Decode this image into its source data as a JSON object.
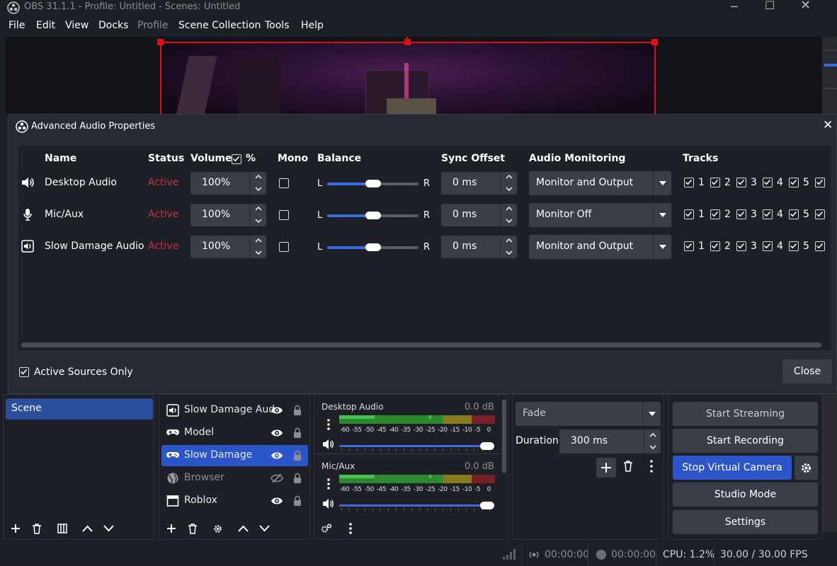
{
  "window": {
    "title": "OBS 31.1.1 - Profile: Untitled - Scenes: Untitled"
  },
  "menu": [
    "File",
    "Edit",
    "View",
    "Docks",
    "Profile",
    "Scene Collection",
    "Tools",
    "Help"
  ],
  "dialog": {
    "title": "Advanced Audio Properties",
    "headers": {
      "name": "Name",
      "status": "Status",
      "volume": "Volume",
      "volume_pct": "%",
      "mono": "Mono",
      "balance": "Balance",
      "sync": "Sync Offset",
      "monitoring": "Audio Monitoring",
      "tracks": "Tracks"
    },
    "balance_l": "L",
    "balance_r": "R",
    "rows": [
      {
        "name": "Desktop Audio",
        "icon": "speaker-icon",
        "status": "Active",
        "volume": "100%",
        "mono": false,
        "balance": 0.5,
        "sync": "0 ms",
        "monitoring": "Monitor and Output"
      },
      {
        "name": "Mic/Aux",
        "icon": "microphone-icon",
        "status": "Active",
        "volume": "100%",
        "mono": false,
        "balance": 0.5,
        "sync": "0 ms",
        "monitoring": "Monitor Off"
      },
      {
        "name": "Slow Damage Audio",
        "icon": "media-speaker-icon",
        "status": "Active",
        "volume": "100%",
        "mono": false,
        "balance": 0.5,
        "sync": "0 ms",
        "monitoring": "Monitor and Output"
      }
    ],
    "track_numbers": [
      "1",
      "2",
      "3",
      "4",
      "5"
    ],
    "active_sources_only": "Active Sources Only",
    "close": "Close"
  },
  "scenes": {
    "items": [
      "Scene"
    ]
  },
  "sources": {
    "items": [
      {
        "name": "Slow Damage Aud",
        "icon": "media-speaker-icon",
        "visible": true,
        "selected": false
      },
      {
        "name": "Model",
        "icon": "gamepad-icon",
        "visible": true,
        "selected": false
      },
      {
        "name": "Slow Damage",
        "icon": "gamepad-icon",
        "visible": true,
        "selected": true
      },
      {
        "name": "Browser",
        "icon": "globe-icon",
        "visible": false,
        "selected": false
      },
      {
        "name": "Roblox",
        "icon": "window-icon",
        "visible": true,
        "selected": false
      }
    ]
  },
  "mixer": {
    "channels": [
      {
        "name": "Desktop Audio",
        "db": "0.0 dB"
      },
      {
        "name": "Mic/Aux",
        "db": "0.0 dB"
      }
    ],
    "scale": [
      "-60",
      "-55",
      "-50",
      "-45",
      "-40",
      "-35",
      "-30",
      "-25",
      "-20",
      "-15",
      "-10",
      "-5",
      "0"
    ]
  },
  "transitions": {
    "type": "Fade",
    "duration_label": "Duration",
    "duration": "300 ms"
  },
  "controls": {
    "start_streaming": "Start Streaming",
    "start_recording": "Start Recording",
    "stop_virtual_camera": "Stop Virtual Camera",
    "studio_mode": "Studio Mode",
    "settings": "Settings"
  },
  "status": {
    "stream_time": "00:00:00",
    "rec_time": "00:00:00",
    "cpu": "CPU: 1.2%",
    "fps": "30.00 / 30.00 FPS"
  }
}
